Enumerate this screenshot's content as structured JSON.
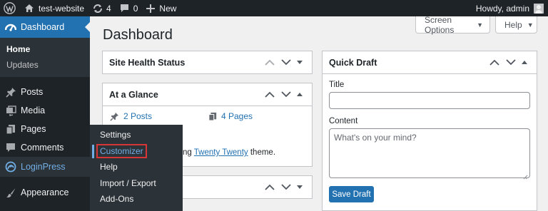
{
  "adminbar": {
    "site_name": "test-website",
    "updates_count": "4",
    "comments_count": "0",
    "new_label": "New",
    "howdy": "Howdy, admin"
  },
  "sidebar": {
    "dashboard_label": "Dashboard",
    "submenu": [
      "Home",
      "Updates"
    ],
    "items": [
      "Posts",
      "Media",
      "Pages",
      "Comments",
      "LoginPress",
      "Appearance"
    ]
  },
  "flyout": {
    "items": [
      "Settings",
      "Customizer",
      "Help",
      "Import / Export",
      "Add-Ons"
    ]
  },
  "main": {
    "title": "Dashboard",
    "screen_options": "Screen Options",
    "help": "Help"
  },
  "widgets": {
    "site_health": "Site Health Status",
    "at_a_glance": "At a Glance",
    "posts_count": "2 Posts",
    "pages_count": "4 Pages",
    "theme_prefix": "ng",
    "theme_name": "Twenty Twenty",
    "theme_suffix": "theme.",
    "quick_draft": "Quick Draft"
  },
  "quick_draft": {
    "title_label": "Title",
    "content_label": "Content",
    "content_placeholder": "What's on your mind?",
    "save_label": "Save Draft"
  },
  "colors": {
    "adminbar_bg": "#1d2327",
    "accent": "#2271b1",
    "link_hover": "#72aee6",
    "highlight_box": "#d63638"
  }
}
